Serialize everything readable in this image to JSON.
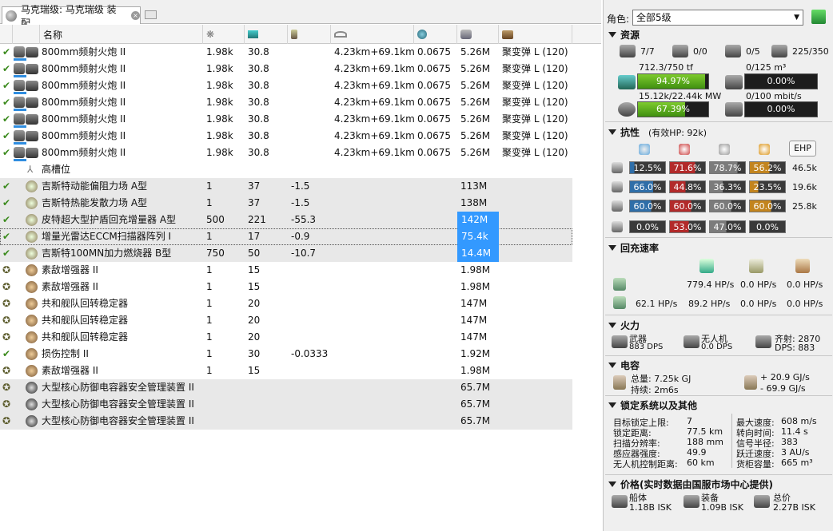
{
  "tab": {
    "title": "马克瑞级: 马克瑞级 装配"
  },
  "columns": [
    "",
    "名称",
    "",
    "",
    "",
    "",
    "",
    "",
    ""
  ],
  "rows": [
    {
      "state": "online",
      "kind": "gun",
      "name": "800mm频射火炮 II",
      "c1": "1.98k",
      "c2": "30.8",
      "c3": "",
      "c4": "4.23km+69.1km",
      "c5": "0.0675",
      "c6": "5.26M",
      "c7": "聚变弹 L (120)",
      "g": false
    },
    {
      "state": "online",
      "kind": "gun",
      "name": "800mm频射火炮 II",
      "c1": "1.98k",
      "c2": "30.8",
      "c3": "",
      "c4": "4.23km+69.1km",
      "c5": "0.0675",
      "c6": "5.26M",
      "c7": "聚变弹 L (120)",
      "g": false
    },
    {
      "state": "online",
      "kind": "gun",
      "name": "800mm频射火炮 II",
      "c1": "1.98k",
      "c2": "30.8",
      "c3": "",
      "c4": "4.23km+69.1km",
      "c5": "0.0675",
      "c6": "5.26M",
      "c7": "聚变弹 L (120)",
      "g": false
    },
    {
      "state": "online",
      "kind": "gun",
      "name": "800mm频射火炮 II",
      "c1": "1.98k",
      "c2": "30.8",
      "c3": "",
      "c4": "4.23km+69.1km",
      "c5": "0.0675",
      "c6": "5.26M",
      "c7": "聚变弹 L (120)",
      "g": false
    },
    {
      "state": "online",
      "kind": "gun",
      "name": "800mm频射火炮 II",
      "c1": "1.98k",
      "c2": "30.8",
      "c3": "",
      "c4": "4.23km+69.1km",
      "c5": "0.0675",
      "c6": "5.26M",
      "c7": "聚变弹 L (120)",
      "g": false
    },
    {
      "state": "online",
      "kind": "gun",
      "name": "800mm频射火炮 II",
      "c1": "1.98k",
      "c2": "30.8",
      "c3": "",
      "c4": "4.23km+69.1km",
      "c5": "0.0675",
      "c6": "5.26M",
      "c7": "聚变弹 L (120)",
      "g": false
    },
    {
      "state": "online",
      "kind": "gun",
      "name": "800mm频射火炮 II",
      "c1": "1.98k",
      "c2": "30.8",
      "c3": "",
      "c4": "4.23km+69.1km",
      "c5": "0.0675",
      "c6": "5.26M",
      "c7": "聚变弹 L (120)",
      "g": false
    },
    {
      "state": "none",
      "kind": "slot",
      "name": "高槽位",
      "c1": "",
      "c2": "",
      "c3": "",
      "c4": "",
      "c5": "",
      "c6": "",
      "c7": "",
      "g": false
    },
    {
      "state": "online",
      "kind": "mod",
      "name": "吉斯特动能偏阻力场 A型",
      "c1": "1",
      "c2": "37",
      "c3": "-1.5",
      "c4": "",
      "c5": "",
      "c6": "113M",
      "c7": "",
      "g": true
    },
    {
      "state": "online",
      "kind": "mod",
      "name": "吉斯特热能发散力场 A型",
      "c1": "1",
      "c2": "37",
      "c3": "-1.5",
      "c4": "",
      "c5": "",
      "c6": "138M",
      "c7": "",
      "g": true
    },
    {
      "state": "online",
      "kind": "mod",
      "name": "皮特超大型护盾回充增量器 A型",
      "c1": "500",
      "c2": "221",
      "c3": "-55.3",
      "c4": "",
      "c5": "",
      "c6": "142M",
      "c7": "",
      "g": true,
      "hl": true
    },
    {
      "state": "online",
      "kind": "mod",
      "name": "增量光雷达ECCM扫描器阵列 I",
      "c1": "1",
      "c2": "17",
      "c3": "-0.9",
      "c4": "",
      "c5": "",
      "c6": "75.4k",
      "c7": "",
      "g": true,
      "hl": true,
      "sel": true
    },
    {
      "state": "online",
      "kind": "mod",
      "name": "吉斯特100MN加力燃烧器 B型",
      "c1": "750",
      "c2": "50",
      "c3": "-10.7",
      "c4": "",
      "c5": "",
      "c6": "14.4M",
      "c7": "",
      "g": true,
      "hl": true
    },
    {
      "state": "passive",
      "kind": "low",
      "name": "素敌增强器 II",
      "c1": "1",
      "c2": "15",
      "c3": "",
      "c4": "",
      "c5": "",
      "c6": "1.98M",
      "c7": "",
      "g": false
    },
    {
      "state": "passive",
      "kind": "low",
      "name": "素敌增强器 II",
      "c1": "1",
      "c2": "15",
      "c3": "",
      "c4": "",
      "c5": "",
      "c6": "1.98M",
      "c7": "",
      "g": false
    },
    {
      "state": "passive",
      "kind": "low",
      "name": "共和舰队回转稳定器",
      "c1": "1",
      "c2": "20",
      "c3": "",
      "c4": "",
      "c5": "",
      "c6": "147M",
      "c7": "",
      "g": false
    },
    {
      "state": "passive",
      "kind": "low",
      "name": "共和舰队回转稳定器",
      "c1": "1",
      "c2": "20",
      "c3": "",
      "c4": "",
      "c5": "",
      "c6": "147M",
      "c7": "",
      "g": false
    },
    {
      "state": "passive",
      "kind": "low",
      "name": "共和舰队回转稳定器",
      "c1": "1",
      "c2": "20",
      "c3": "",
      "c4": "",
      "c5": "",
      "c6": "147M",
      "c7": "",
      "g": false
    },
    {
      "state": "online",
      "kind": "low",
      "name": "损伤控制 II",
      "c1": "1",
      "c2": "30",
      "c3": "-0.0333",
      "c4": "",
      "c5": "",
      "c6": "1.92M",
      "c7": "",
      "g": false
    },
    {
      "state": "passive",
      "kind": "low",
      "name": "素敌增强器 II",
      "c1": "1",
      "c2": "15",
      "c3": "",
      "c4": "",
      "c5": "",
      "c6": "1.98M",
      "c7": "",
      "g": false
    },
    {
      "state": "passive",
      "kind": "rig",
      "name": "大型核心防御电容器安全管理装置 II",
      "c1": "",
      "c2": "",
      "c3": "",
      "c4": "",
      "c5": "",
      "c6": "65.7M",
      "c7": "",
      "g": true
    },
    {
      "state": "passive",
      "kind": "rig",
      "name": "大型核心防御电容器安全管理装置 II",
      "c1": "",
      "c2": "",
      "c3": "",
      "c4": "",
      "c5": "",
      "c6": "65.7M",
      "c7": "",
      "g": true
    },
    {
      "state": "passive",
      "kind": "rig",
      "name": "大型核心防御电容器安全管理装置 II",
      "c1": "",
      "c2": "",
      "c3": "",
      "c4": "",
      "c5": "",
      "c6": "65.7M",
      "c7": "",
      "g": true
    }
  ],
  "side": {
    "char_label": "角色:",
    "char_value": "全部5级",
    "resources": {
      "title": "资源",
      "turret": "7/7",
      "launcher": "0/0",
      "drone_bay": "0/5",
      "calib": "225/350",
      "cpu_text": "712.3/750 tf",
      "cpu_pct": "94.97%",
      "cpu_frac": 0.9497,
      "drone_bw_text": "0/125 m³",
      "drone_bw_pct": "0.00%",
      "pg_text": "15.12k/22.44k MW",
      "pg_pct": "67.39%",
      "pg_frac": 0.6739,
      "drone_cap_text": "0/100 mbit/s",
      "drone_cap_pct": "0.00%"
    },
    "resist": {
      "title": "抗性",
      "ehp": "(有效HP: 92k)",
      "ehp_btn": "EHP",
      "rows": [
        {
          "vals": [
            "12.5%",
            "71.6%",
            "78.7%",
            "56.2%"
          ],
          "hp": "46.5k"
        },
        {
          "vals": [
            "66.0%",
            "44.8%",
            "36.3%",
            "23.5%"
          ],
          "hp": "19.6k"
        },
        {
          "vals": [
            "60.0%",
            "60.0%",
            "60.0%",
            "60.0%"
          ],
          "hp": "25.8k"
        },
        {
          "vals": [
            "0.0%",
            "53.0%",
            "47.0%",
            "0.0%"
          ],
          "hp": ""
        }
      ]
    },
    "recharge": {
      "title": "回充速率",
      "r1": [
        "779.4 HP/s",
        "0.0 HP/s",
        "0.0 HP/s"
      ],
      "r2": [
        "62.1 HP/s",
        "89.2 HP/s",
        "0.0 HP/s",
        "0.0 HP/s"
      ]
    },
    "firepower": {
      "title": "火力",
      "weapon_label": "武器",
      "weapon_dps": "883 DPS",
      "drone_label": "无人机",
      "drone_dps": "0.0 DPS",
      "volley_label": "齐射: 2870",
      "total_dps": "DPS: 883"
    },
    "cap": {
      "title": "电容",
      "total": "总量: 7.25k GJ",
      "lasts": "持续: 2m6s",
      "plus": "+ 20.9 GJ/s",
      "minus": "- 69.9 GJ/s"
    },
    "targeting": {
      "title": "锁定系统以及其他",
      "left": [
        [
          "目标锁定上限:",
          "7"
        ],
        [
          "锁定距离:",
          "77.5 km"
        ],
        [
          "扫描分辨率:",
          "188 mm"
        ],
        [
          "感应器强度:",
          "49.9"
        ],
        [
          "无人机控制距离:",
          "60 km"
        ]
      ],
      "right": [
        [
          "最大速度:",
          "608 m/s"
        ],
        [
          "转向时间:",
          "11.4 s"
        ],
        [
          "信号半径:",
          "383"
        ],
        [
          "跃迁速度:",
          "3 AU/s"
        ],
        [
          "货柜容量:",
          "665 m³"
        ]
      ]
    },
    "price": {
      "title": "价格(实时数据由国服市场中心提供)",
      "hull_label": "船体",
      "hull": "1.18B ISK",
      "fit_label": "装备",
      "fit": "1.09B ISK",
      "total_label": "总价",
      "total": "2.27B ISK"
    }
  }
}
